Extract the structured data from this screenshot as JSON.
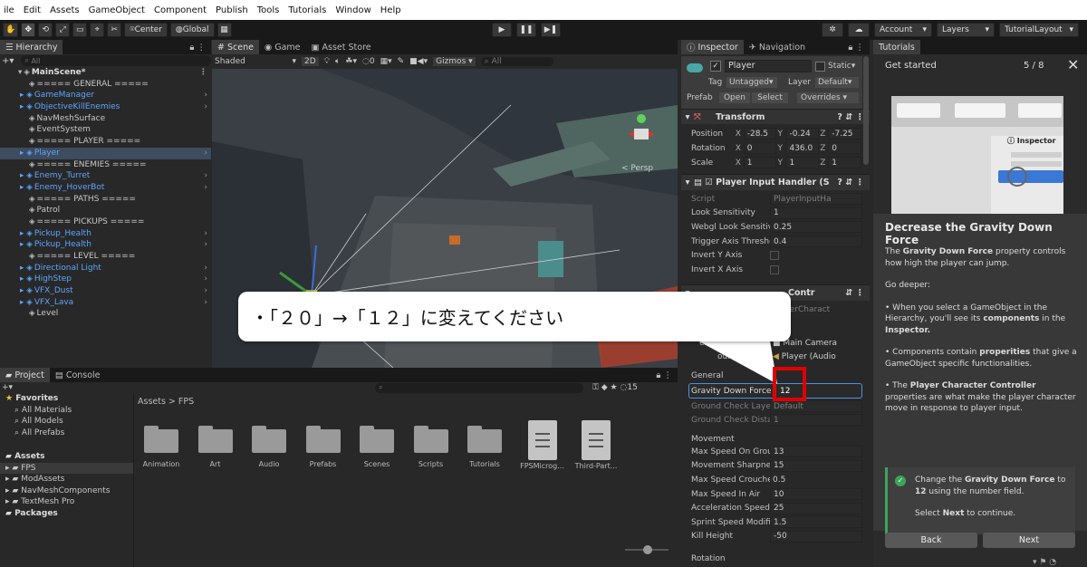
{
  "menu": [
    "ile",
    "Edit",
    "Assets",
    "GameObject",
    "Component",
    "Publish",
    "Tools",
    "Tutorials",
    "Window",
    "Help"
  ],
  "toolbar": {
    "center": "Center",
    "global": "Global",
    "account": "Account",
    "layers": "Layers",
    "layout": "TutorialLayout"
  },
  "hierarchy": {
    "tab": "Hierarchy",
    "search": "All",
    "scene": "MainScene*",
    "items": [
      {
        "label": "===== GENERAL =====",
        "blue": false,
        "arrow": false
      },
      {
        "label": "GameManager",
        "blue": true,
        "arrow": true
      },
      {
        "label": "ObjectiveKillEnemies",
        "blue": true,
        "arrow": true
      },
      {
        "label": "NavMeshSurface",
        "blue": false,
        "arrow": false
      },
      {
        "label": "EventSystem",
        "blue": false,
        "arrow": false
      },
      {
        "label": "===== PLAYER =====",
        "blue": false,
        "arrow": false
      },
      {
        "label": "Player",
        "blue": true,
        "arrow": true,
        "selected": true
      },
      {
        "label": "===== ENEMIES =====",
        "blue": false,
        "arrow": false
      },
      {
        "label": "Enemy_Turret",
        "blue": true,
        "arrow": true
      },
      {
        "label": "Enemy_HoverBot",
        "blue": true,
        "arrow": true
      },
      {
        "label": "===== PATHS =====",
        "blue": false,
        "arrow": false
      },
      {
        "label": "Patrol",
        "blue": false,
        "arrow": false
      },
      {
        "label": "===== PICKUPS =====",
        "blue": false,
        "arrow": false
      },
      {
        "label": "Pickup_Health",
        "blue": true,
        "arrow": true
      },
      {
        "label": "Pickup_Health",
        "blue": true,
        "arrow": true
      },
      {
        "label": "===== LEVEL =====",
        "blue": false,
        "arrow": false
      },
      {
        "label": "Directional Light",
        "blue": true,
        "arrow": true
      },
      {
        "label": "HighStep",
        "blue": true,
        "arrow": true
      },
      {
        "label": "VFX_Dust",
        "blue": true,
        "arrow": true
      },
      {
        "label": "VFX_Lava",
        "blue": true,
        "arrow": true
      },
      {
        "label": "Level",
        "blue": false,
        "arrow": false
      }
    ]
  },
  "scene": {
    "tabs": [
      "Scene",
      "Game",
      "Asset Store"
    ],
    "shading": "Shaded",
    "mode2d": "2D",
    "hidden_count": "0",
    "gizmos": "Gizmos",
    "search": "All",
    "persp": "< Persp"
  },
  "project": {
    "tabs": [
      "Project",
      "Console"
    ],
    "hidden_count": "15",
    "favorites": "Favorites",
    "fav_items": [
      "All Materials",
      "All Models",
      "All Prefabs"
    ],
    "assets_root": "Assets",
    "tree": [
      "FPS",
      "ModAssets",
      "NavMeshComponents",
      "TextMesh Pro"
    ],
    "packages": "Packages",
    "breadcrumb": "Assets > FPS",
    "folders": [
      "Animation",
      "Art",
      "Audio",
      "Prefabs",
      "Scenes",
      "Scripts",
      "Tutorials"
    ],
    "files": [
      "FPSMicrog...",
      "Third-Part..."
    ]
  },
  "inspector": {
    "tabs": [
      "Inspector",
      "Navigation"
    ],
    "name": "Player",
    "static": "Static",
    "tag_label": "Tag",
    "tag": "Untagged",
    "layer_label": "Layer",
    "layer": "Default",
    "prefab": "Prefab",
    "open": "Open",
    "select": "Select",
    "overrides": "Overrides",
    "transform": "Transform",
    "position": {
      "label": "Position",
      "x": "-28.5",
      "y": "-0.24",
      "z": "-7.25"
    },
    "rotation": {
      "label": "Rotation",
      "x": "0",
      "y": "436.0",
      "z": "0"
    },
    "scale": {
      "label": "Scale",
      "x": "1",
      "y": "1",
      "z": "1"
    },
    "pih_title": "Player Input Handler (S",
    "pih_rows": [
      {
        "label": "Script",
        "value": "PlayerInputHa",
        "dim": true
      },
      {
        "label": "Look Sensitivity",
        "value": "1"
      },
      {
        "label": "Webgl Look Sensitiv",
        "value": "0.25"
      },
      {
        "label": "Trigger Axis Thresho",
        "value": "0.4"
      },
      {
        "label": "Invert Y Axis",
        "value": ""
      },
      {
        "label": "Invert X Axis",
        "value": ""
      }
    ],
    "pcc_title": "Contr",
    "pcc_script": "PlayerCharact",
    "main_camera": "Main Camera",
    "camera_label": "el Camera",
    "audio_label": "ource",
    "audio_value": "Player (Audio",
    "general": "General",
    "gravity": {
      "label": "Gravity Down Force",
      "value": "12"
    },
    "ground_layers": {
      "label": "Ground Check Layer",
      "value": "Default"
    },
    "ground_dist": {
      "label": "Ground Check Distar",
      "value": "1"
    },
    "movement": "Movement",
    "movement_rows": [
      {
        "label": "Max Speed On Grour",
        "value": "13"
      },
      {
        "label": "Movement Sharpnes",
        "value": "15"
      },
      {
        "label": "Max Speed Crouche",
        "value": "0.5"
      },
      {
        "label": "Max Speed In Air",
        "value": "10"
      },
      {
        "label": "Acceleration Speed I",
        "value": "25"
      },
      {
        "label": "Sprint Speed Modifie",
        "value": "1.5"
      },
      {
        "label": "Kill Height",
        "value": "-50"
      }
    ],
    "crouch_slider": 0.32,
    "rotation_section": "Rotation"
  },
  "tutorials": {
    "tab": "Tutorials",
    "heading": "Get started",
    "progress": "5 / 8",
    "preview_label": "Inspector",
    "title": "Decrease the Gravity Down Force",
    "p1a": "The ",
    "p1b": "Gravity Down Force",
    "p1c": " property controls how high the player can jump.",
    "p2": "Go deeper:",
    "p3a": "• When you select a GameObject in the Hierarchy, you'll see its ",
    "p3b": "components",
    "p3c": " in the ",
    "p3d": "Inspector.",
    "p4a": "• Components contain ",
    "p4b": "properities",
    "p4c": " that give a GameObject specific functionalities.",
    "p5a": "• The ",
    "p5b": "Player Character Controller",
    "p5c": " properties are what make the player character move in response to player input.",
    "task_a": "Change the ",
    "task_b": "Gravity Down Force",
    "task_c": " to ",
    "task_d": "12",
    "task_e": " using the number field.",
    "task2a": "Select ",
    "task2b": "Next",
    "task2c": " to continue.",
    "back": "Back",
    "next": "Next"
  },
  "callout": "・「２０」→「１２」に変えてください",
  "colors": {
    "accent_blue": "#5da5ff",
    "selection": "#3d4c5e",
    "highlight": "#e00000",
    "check_green": "#3ea35a"
  }
}
